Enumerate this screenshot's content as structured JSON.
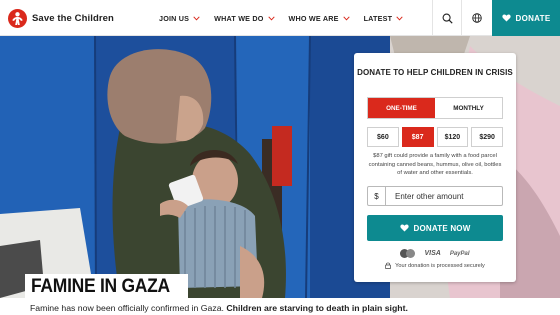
{
  "header": {
    "logo_text": "Save the Children",
    "nav": [
      {
        "label": "JOIN US"
      },
      {
        "label": "WHAT WE DO"
      },
      {
        "label": "WHO WE ARE"
      },
      {
        "label": "LATEST"
      }
    ],
    "donate_label": "DONATE",
    "icons": {
      "search": "search-icon",
      "language": "globe-icon",
      "donate": "heart-icon",
      "chevron": "chevron-down-icon"
    }
  },
  "hero": {
    "headline": "FAMINE IN GAZA",
    "caption_plain": "Famine has now been officially confirmed in Gaza. ",
    "caption_bold": "Children are starving to death in plain sight."
  },
  "donate_card": {
    "title": "DONATE TO HELP CHILDREN IN CRISIS",
    "frequency": {
      "one_time": "ONE-TIME",
      "monthly": "MONTHLY",
      "selected": "ONE-TIME"
    },
    "amounts": [
      "$60",
      "$87",
      "$120",
      "$290"
    ],
    "selected_amount": "$87",
    "description": "$87 gift could provide a family with a food parcel containing canned beans, hummus, olive oil, bottles of water and other essentials.",
    "other_amount": {
      "currency": "$",
      "placeholder": "Enter other amount",
      "value": ""
    },
    "submit_label": "DONATE NOW",
    "payment_methods": {
      "visa": "VISA",
      "paypal": "PayPal",
      "mastercard": "mastercard-icon"
    },
    "secure_text": "Your donation is processed securely"
  },
  "colors": {
    "brand_red": "#da291c",
    "teal": "#0d8a90",
    "tent_blue": "#1f57a8"
  }
}
